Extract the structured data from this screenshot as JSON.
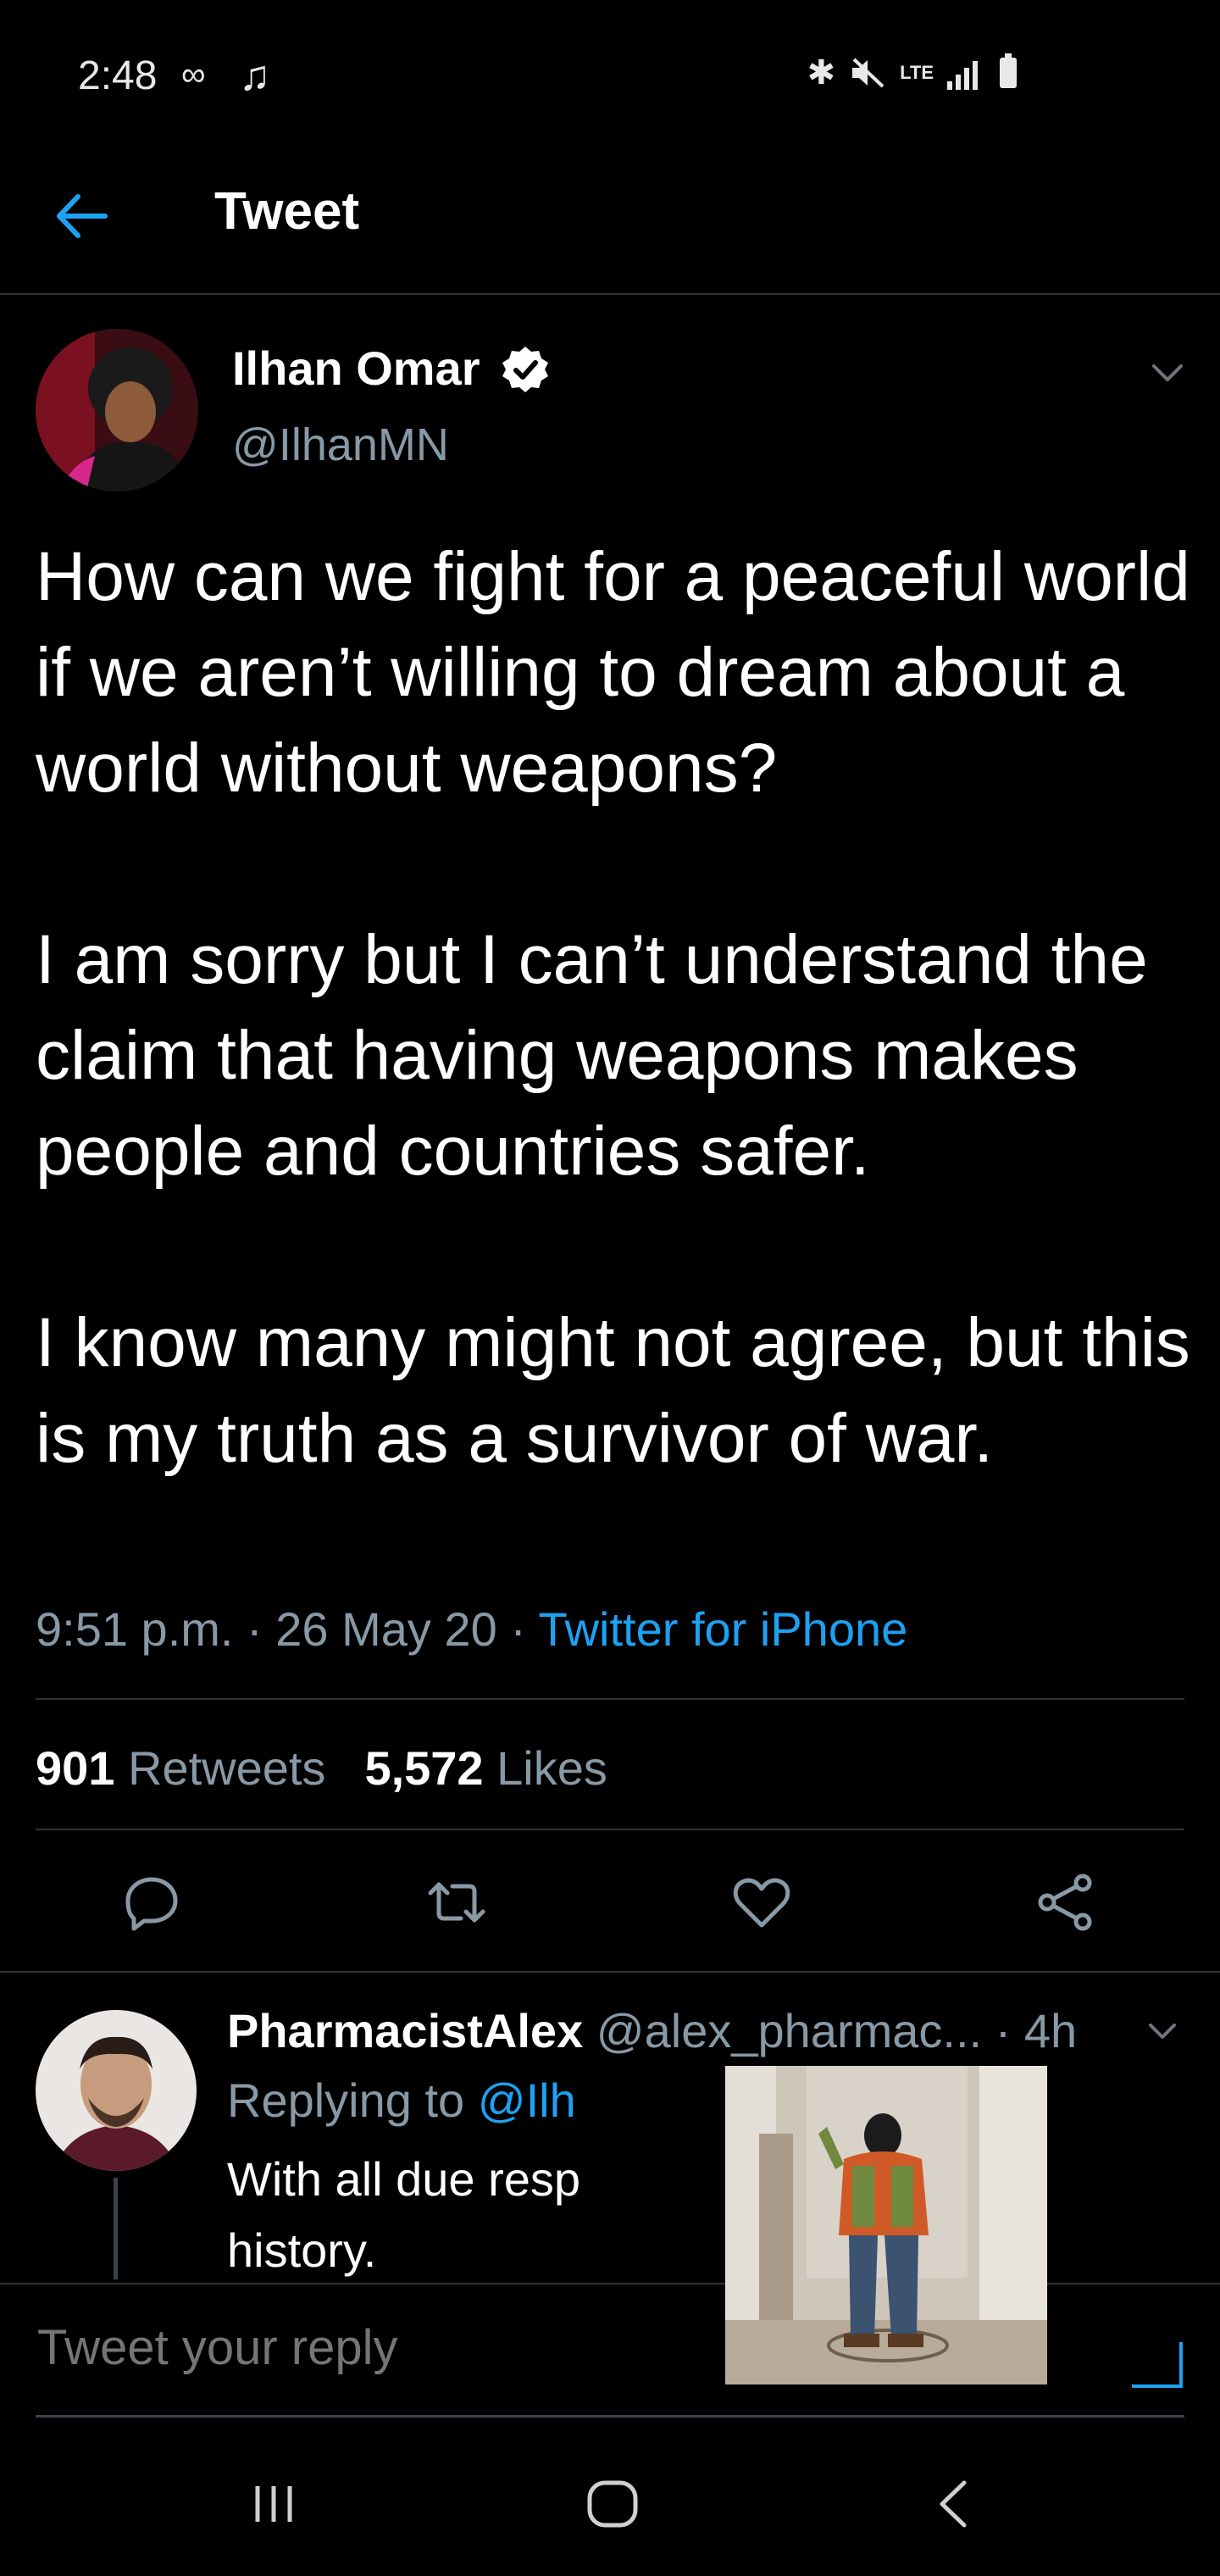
{
  "status_bar": {
    "time": "2:48",
    "left_icons": [
      "voicemail-icon",
      "music-note-icon"
    ],
    "right_icons": [
      "bluetooth-icon",
      "mute-icon",
      "lte-icon",
      "signal-icon",
      "battery-icon"
    ],
    "network": "LTE"
  },
  "header": {
    "title": "Tweet"
  },
  "tweet": {
    "author_name": "Ilhan Omar",
    "handle": "@IlhanMN",
    "verified": true,
    "text": "How can we fight for a peaceful world if we aren’t willing to dream about a world without weapons?\n\nI am sorry but I can’t understand the claim that having weapons makes people and countries safer.\n\nI know many might not agree, but this is my truth as a survivor of war.",
    "time": "9:51 p.m.",
    "date": "26 May 20",
    "source": "Twitter for iPhone",
    "separator": " · ",
    "retweets_count": "901",
    "retweets_label": "Retweets",
    "likes_count": "5,572",
    "likes_label": "Likes"
  },
  "reply": {
    "author_name": "PharmacistAlex",
    "handle": "@alex_pharmac...",
    "age": "· 4h",
    "replying_prefix": "Replying to",
    "replying_to": "@Ilh",
    "text": "With all due resp history."
  },
  "composer": {
    "placeholder": "Tweet your reply"
  },
  "colors": {
    "background": "#000000",
    "accent": "#1da1f2",
    "secondary_text": "#8899a6",
    "divider": "#2f3336"
  }
}
